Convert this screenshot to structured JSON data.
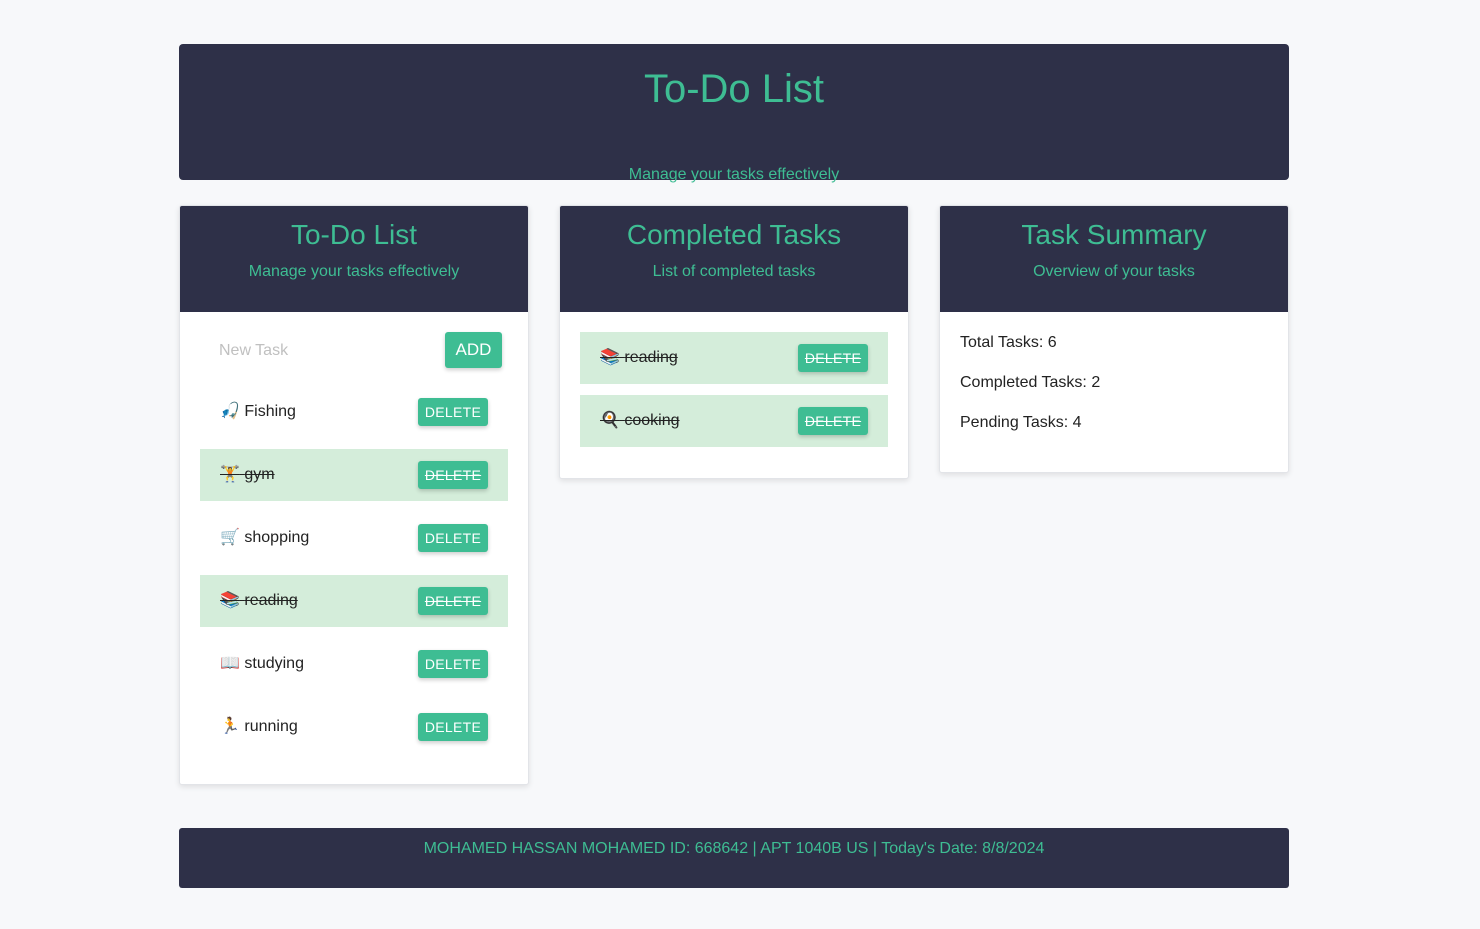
{
  "header": {
    "title": "To-Do List",
    "subtitle": "Manage your tasks effectively"
  },
  "todo": {
    "title": "To-Do List",
    "subtitle": "Manage your tasks effectively",
    "new_task_placeholder": "New Task",
    "add_label": "ADD",
    "delete_label": "DELETE",
    "tasks": [
      {
        "icon": "🎣",
        "text": "Fishing",
        "completed": false
      },
      {
        "icon": "🏋️",
        "text": "gym",
        "completed": true
      },
      {
        "icon": "🛒",
        "text": "shopping",
        "completed": false
      },
      {
        "icon": "📚",
        "text": "reading",
        "completed": true
      },
      {
        "icon": "📖",
        "text": "studying",
        "completed": false
      },
      {
        "icon": "🏃",
        "text": "running",
        "completed": false
      }
    ]
  },
  "completed": {
    "title": "Completed Tasks",
    "subtitle": "List of completed tasks",
    "delete_label": "DELETE",
    "tasks": [
      {
        "icon": "📚",
        "text": "reading"
      },
      {
        "icon": "🍳",
        "text": "cooking"
      }
    ]
  },
  "summary": {
    "title": "Task Summary",
    "subtitle": "Overview of your tasks",
    "total": "Total Tasks: 6",
    "completed": "Completed Tasks: 2",
    "pending": "Pending Tasks: 4"
  },
  "footer": {
    "text": "MOHAMED HASSAN MOHAMED ID: 668642 | APT 1040B US | Today's Date: 8/8/2024"
  },
  "colors": {
    "accent": "#3ebd93",
    "header_bg": "#2e3048",
    "done_bg": "#d4edda"
  }
}
